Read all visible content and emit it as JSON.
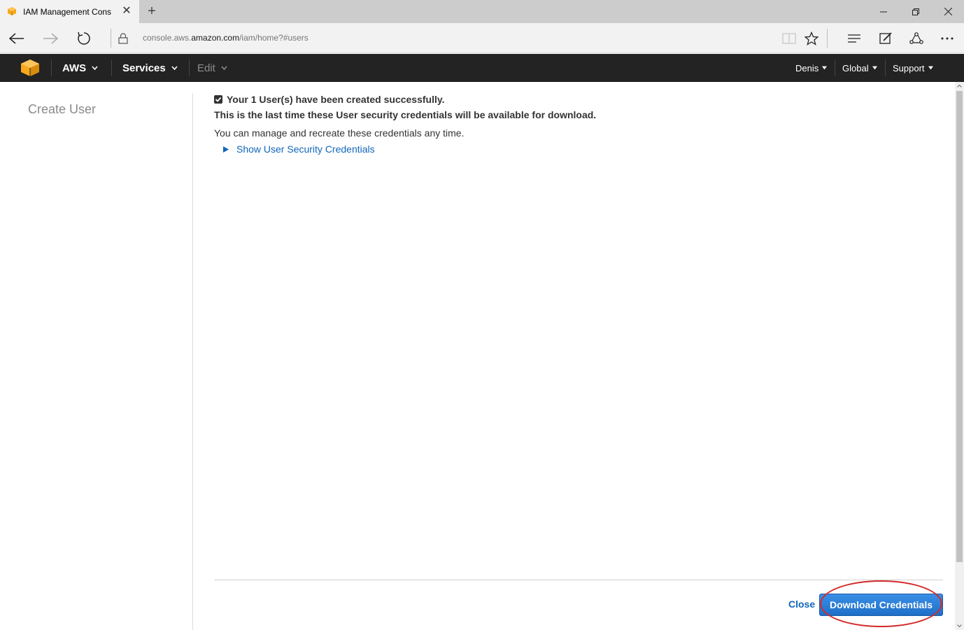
{
  "browser": {
    "tab_title": "IAM Management Cons",
    "tab_favicon": "aws-box-icon",
    "url_prefix": "console.aws.",
    "url_domain": "amazon.com",
    "url_path": "/iam/home?#users"
  },
  "aws_nav": {
    "items": [
      {
        "label": "AWS"
      },
      {
        "label": "Services"
      },
      {
        "label": "Edit"
      }
    ],
    "right_items": [
      {
        "label": "Denis"
      },
      {
        "label": "Global"
      },
      {
        "label": "Support"
      }
    ],
    "logo_color": "#f7a81b"
  },
  "sidebar": {
    "title": "Create User"
  },
  "main": {
    "success_message": "Your 1 User(s) have been created successfully.",
    "warning_message": "This is the last time these User security credentials will be available for download.",
    "info_message": "You can manage and recreate these credentials any time.",
    "show_credentials_label": "Show User Security Credentials"
  },
  "footer": {
    "close_label": "Close",
    "download_label": "Download Credentials"
  },
  "colors": {
    "link": "#1166bb",
    "primary_button": "#2a7dd8",
    "nav_bg": "#232323",
    "highlight": "#d42a2a"
  }
}
